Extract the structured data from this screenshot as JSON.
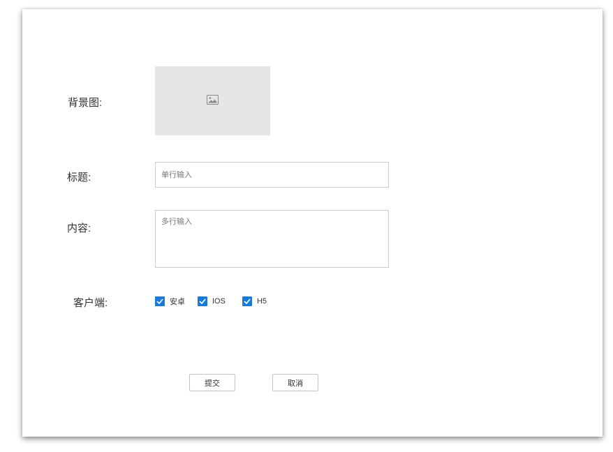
{
  "form": {
    "background_label": "背景图:",
    "title_label": "标题:",
    "content_label": "内容:",
    "client_label": "客户端:",
    "title_placeholder": "单行输入",
    "content_placeholder": "多行输入",
    "image_icon": "image-icon",
    "clients": [
      {
        "label": "安卓",
        "checked": true
      },
      {
        "label": "IOS",
        "checked": true
      },
      {
        "label": "H5",
        "checked": true
      }
    ],
    "submit_label": "提交",
    "cancel_label": "取消"
  },
  "colors": {
    "checkbox_accent": "#1a7ad9",
    "placeholder_bg": "#e6e6e6",
    "border": "#cccccc"
  }
}
